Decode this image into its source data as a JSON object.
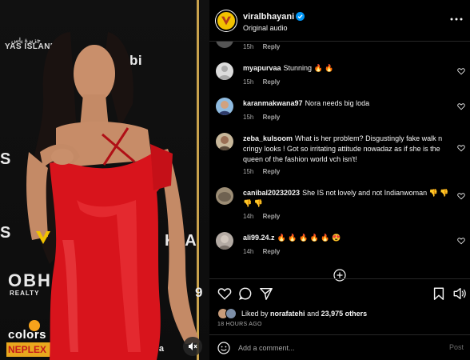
{
  "media": {
    "wall_text": {
      "yas_arabic": "جزيرة ياس",
      "yas": "YAS ISLAND",
      "abhi": "abi",
      "bh": "OBH",
      "realty": "REALTY",
      "ka": "K A",
      "s8": "S",
      "s9": "9",
      "ema": "ema",
      "colors": "colors",
      "neplex": "NEPLEX"
    },
    "watermark_icon": "viralbhayani-v-logo",
    "mute_icon": "speaker-muted-icon"
  },
  "header": {
    "username": "viralbhayani",
    "subtitle": "Original audio",
    "verified_icon": "verified-badge-icon",
    "more_icon": "more-horizontal-icon"
  },
  "comments": {
    "partial": {
      "time": "15h",
      "reply": "Reply"
    },
    "items": [
      {
        "user": "myapurvaa",
        "text": "Stunning 🔥 🔥",
        "time": "15h",
        "reply": "Reply",
        "avatar_color": "#dcdcdc"
      },
      {
        "user": "karanmakwana97",
        "text": "Nora needs big loda",
        "time": "15h",
        "reply": "Reply",
        "avatar_color": "#8fbbe0"
      },
      {
        "user": "zeba_kulsoom",
        "text": "What is her problem? Disgustingly fake walk n cringy looks ! Got so irritating attitude nowadaz as if she is the queen of the fashion world vch isn't!",
        "time": "15h",
        "reply": "Reply",
        "avatar_color": "#c8b79a"
      },
      {
        "user": "canibal20232023",
        "text": "She IS not lovely and not Indianwoman 👎 👎 👎 👎",
        "time": "14h",
        "reply": "Reply",
        "avatar_color": "#9c8d75"
      },
      {
        "user": "ali99.24.z",
        "text": "🔥 🔥 🔥 🔥 🔥 😍",
        "time": "14h",
        "reply": "Reply",
        "avatar_color": "#b3aaa3"
      }
    ]
  },
  "likes": {
    "prefix": "Liked by",
    "user": "norafatehi",
    "middle": "and",
    "count": "23,975 others"
  },
  "posted": "18 HOURS AGO",
  "add_comment": {
    "placeholder": "Add a comment...",
    "post": "Post"
  },
  "colors": {
    "bg": "#000000",
    "text": "#f5f5f5",
    "muted": "#a8a8a8",
    "accent_verified": "#0095f6",
    "dress_red": "#d8141c"
  }
}
